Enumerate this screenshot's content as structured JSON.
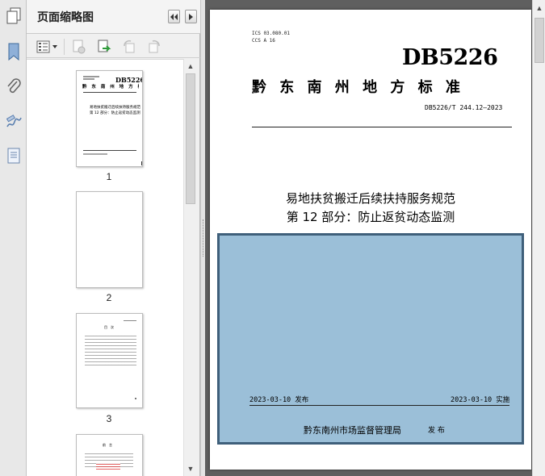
{
  "panel": {
    "title": "页面缩略图"
  },
  "thumbnails": [
    {
      "number": "1",
      "lines": [
        "易地扶贫搬迁后续扶持服务规范",
        "第 12 部分：防止返贫动态监测"
      ]
    },
    {
      "number": "2"
    },
    {
      "number": "3",
      "heading": "目　次"
    },
    {
      "number": "4",
      "heading": "前　言"
    }
  ],
  "document": {
    "ics": "ICS 03.080.01",
    "ccs": "CCS A 16",
    "db_mark": "DB5226",
    "region_title": "黔 东 南 州 地 方 标 准",
    "standard_no": "DB5226/T 244.12—2023",
    "title_line1": "易地扶贫搬迁后续扶持服务规范",
    "title_line2": "第 12 部分：防止返贫动态监测",
    "publish_date": "2023-03-10 发布",
    "implement_date": "2023-03-10 实施",
    "issuer": "黔东南州市场监督管理局",
    "issue_word": "发 布"
  },
  "colors": {
    "selection_fill": "#9bbfd8",
    "selection_border": "#3f5f7a",
    "doc_background": "#5f5f5f"
  }
}
